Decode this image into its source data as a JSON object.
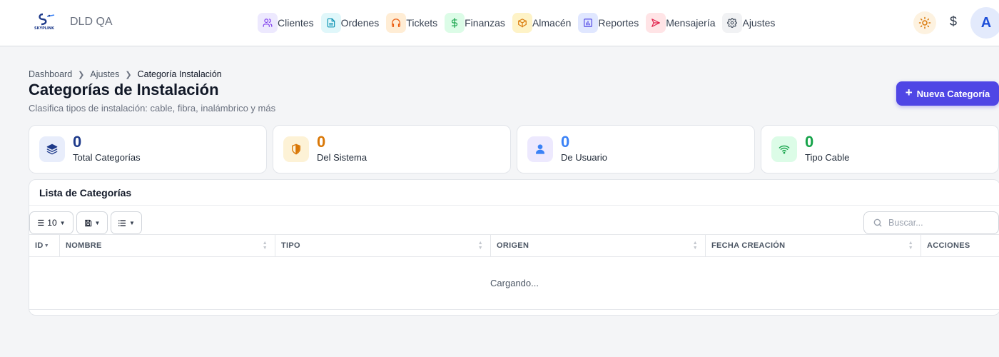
{
  "app": {
    "brand": "DLD QA",
    "logo_text": "SKYPLINK"
  },
  "nav": [
    {
      "label": "Clientes",
      "icon": "users-icon",
      "bg": "#ede9fe",
      "fg": "#7c3aed"
    },
    {
      "label": "Ordenes",
      "icon": "document-icon",
      "bg": "#e0f7fa",
      "fg": "#0891b2"
    },
    {
      "label": "Tickets",
      "icon": "headset-icon",
      "bg": "#ffedd5",
      "fg": "#ea580c"
    },
    {
      "label": "Finanzas",
      "icon": "dollar-icon",
      "bg": "#dcfce7",
      "fg": "#16a34a"
    },
    {
      "label": "Almacén",
      "icon": "box-icon",
      "bg": "#fef3c7",
      "fg": "#d97706"
    },
    {
      "label": "Reportes",
      "icon": "bar-chart-icon",
      "bg": "#e0e7ff",
      "fg": "#4f46e5"
    },
    {
      "label": "Mensajería",
      "icon": "send-icon",
      "bg": "#ffe4e6",
      "fg": "#e11d48"
    },
    {
      "label": "Ajustes",
      "icon": "gear-icon",
      "bg": "#f1f2f4",
      "fg": "#4b5563"
    }
  ],
  "toolbar": {
    "currency_symbol": "$",
    "avatar_initial": "A"
  },
  "breadcrumb": {
    "items": [
      "Dashboard",
      "Ajustes"
    ],
    "current": "Categoría Instalación"
  },
  "page": {
    "title": "Categorías de Instalación",
    "subtitle": "Clasifica tipos de instalación: cable, fibra, inalámbrico y más",
    "new_button": "Nueva Categoría"
  },
  "stats": [
    {
      "value": "0",
      "label": "Total Categorías",
      "icon": "layers-icon",
      "color": "#1e3a8a",
      "bg": "#e8edfb"
    },
    {
      "value": "0",
      "label": "Del Sistema",
      "icon": "shield-icon",
      "color": "#d97706",
      "bg": "#fdf2d6"
    },
    {
      "value": "0",
      "label": "De Usuario",
      "icon": "user-icon",
      "color": "#3b82f6",
      "bg": "#ede9fe"
    },
    {
      "value": "0",
      "label": "Tipo Cable",
      "icon": "wifi-icon",
      "color": "#16a34a",
      "bg": "#dcfce7"
    }
  ],
  "list": {
    "title": "Lista de Categorías",
    "page_size": "10",
    "search_placeholder": "Buscar...",
    "columns": [
      "ID",
      "NOMBRE",
      "TIPO",
      "ORIGEN",
      "FECHA CREACIÓN",
      "ACCIONES"
    ],
    "loading_text": "Cargando..."
  }
}
